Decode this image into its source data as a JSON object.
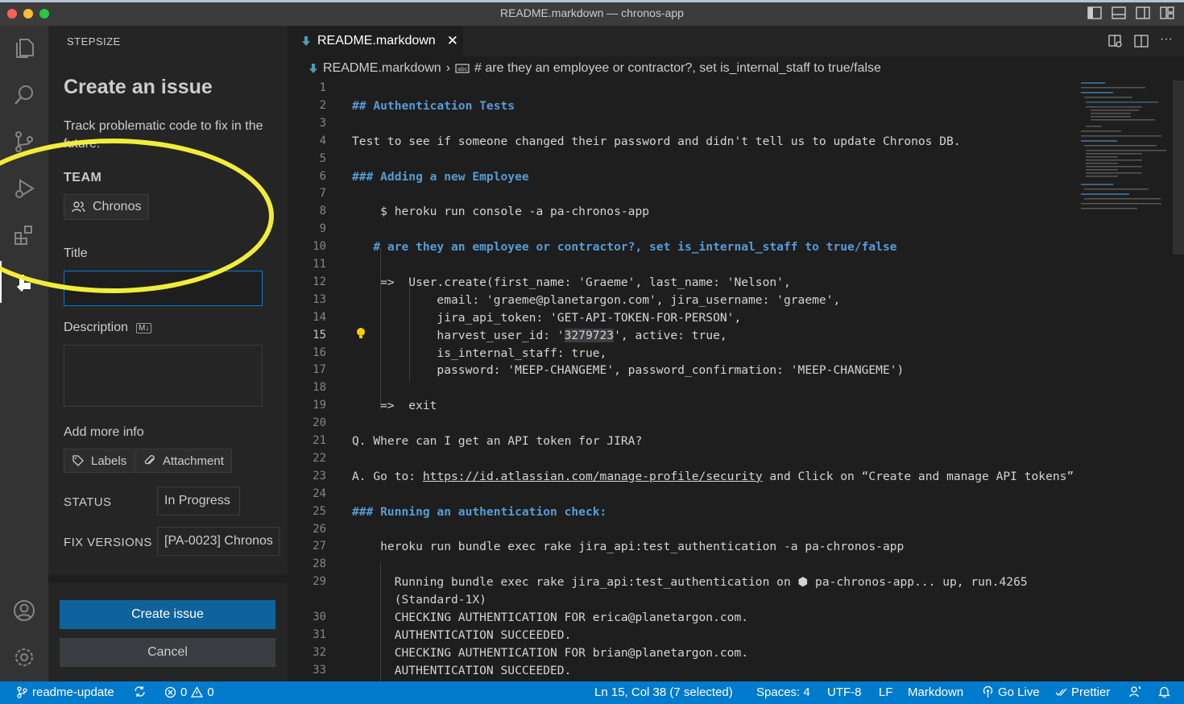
{
  "window": {
    "title": "README.markdown — chronos-app"
  },
  "sidebar": {
    "header": "STEPSIZE",
    "title": "Create an issue",
    "description": "Track problematic code to fix in the future.",
    "team_label": "TEAM",
    "team_value": "Chronos",
    "title_label": "Title",
    "title_value": "",
    "description_label": "Description",
    "description_badge": "M↓",
    "add_more_label": "Add more info",
    "labels_button": "Labels",
    "attachment_button": "Attachment",
    "status_label": "STATUS",
    "status_value": "In Progress",
    "fix_versions_label": "FIX VERSIONS",
    "fix_versions_value": "[PA-0023] Chronos",
    "create_button": "Create issue",
    "cancel_button": "Cancel"
  },
  "editor": {
    "tab_label": "README.markdown",
    "breadcrumb_file": "README.markdown",
    "breadcrumb_symbol": "# are they an employee or contractor?, set is_internal_staff to true/false",
    "current_line": 15,
    "lines": [
      {
        "n": "1",
        "text": ""
      },
      {
        "n": "2",
        "text": "## Authentication Tests"
      },
      {
        "n": "3",
        "text": ""
      },
      {
        "n": "4",
        "text": "Test to see if someone changed their password and didn't tell us to update Chronos DB."
      },
      {
        "n": "5",
        "text": ""
      },
      {
        "n": "6",
        "text": "### Adding a new Employee"
      },
      {
        "n": "7",
        "text": ""
      },
      {
        "n": "8",
        "text": "    $ heroku run console -a pa-chronos-app"
      },
      {
        "n": "9",
        "text": ""
      },
      {
        "n": "10",
        "text": "   # are they an employee or contractor?, set is_internal_staff to true/false"
      },
      {
        "n": "11",
        "text": ""
      },
      {
        "n": "12",
        "text": "    =>  User.create(first_name: 'Graeme', last_name: 'Nelson',"
      },
      {
        "n": "13",
        "text": "            email: 'graeme@planetargon.com', jira_username: 'graeme',"
      },
      {
        "n": "14",
        "text": "            jira_api_token: 'GET-API-TOKEN-FOR-PERSON',"
      },
      {
        "n": "15",
        "text_before": "            harvest_user_id: '",
        "selected": "3279723",
        "text_after": "', active: true,"
      },
      {
        "n": "16",
        "text": "            is_internal_staff: true,"
      },
      {
        "n": "17",
        "text": "            password: 'MEEP-CHANGEME', password_confirmation: 'MEEP-CHANGEME')"
      },
      {
        "n": "18",
        "text": ""
      },
      {
        "n": "19",
        "text": "    =>  exit"
      },
      {
        "n": "20",
        "text": ""
      },
      {
        "n": "21",
        "text": "Q. Where can I get an API token for JIRA?"
      },
      {
        "n": "22",
        "text": ""
      },
      {
        "n": "23",
        "text_before": "A. Go to: ",
        "link": "https://id.atlassian.com/manage-profile/security",
        "text_after": " and Click on “Create and manage API tokens”"
      },
      {
        "n": "24",
        "text": ""
      },
      {
        "n": "25",
        "text": "### Running an authentication check:"
      },
      {
        "n": "26",
        "text": ""
      },
      {
        "n": "27",
        "text": "    heroku run bundle exec rake jira_api:test_authentication -a pa-chronos-app"
      },
      {
        "n": "28",
        "text": ""
      },
      {
        "n": "29",
        "text": "      Running bundle exec rake jira_api:test_authentication on ⬢ pa-chronos-app... up, run.4265"
      },
      {
        "n": "",
        "text": "      (Standard-1X)"
      },
      {
        "n": "30",
        "text": "      CHECKING AUTHENTICATION FOR erica@planetargon.com."
      },
      {
        "n": "31",
        "text": "      AUTHENTICATION SUCCEEDED."
      },
      {
        "n": "32",
        "text": "      CHECKING AUTHENTICATION FOR brian@planetargon.com."
      },
      {
        "n": "33",
        "text": "      AUTHENTICATION SUCCEEDED."
      }
    ]
  },
  "statusbar": {
    "branch": "readme-update",
    "errors": "0",
    "warnings": "0",
    "position": "Ln 15, Col 38 (7 selected)",
    "spaces": "Spaces: 4",
    "encoding": "UTF-8",
    "eol": "LF",
    "language": "Markdown",
    "go_live": "Go Live",
    "prettier": "Prettier"
  },
  "colors": {
    "statusbar": "#007acc",
    "primary_button": "#0e639c",
    "heading": "#569cd6",
    "highlight_circle": "#f2ec3a"
  }
}
